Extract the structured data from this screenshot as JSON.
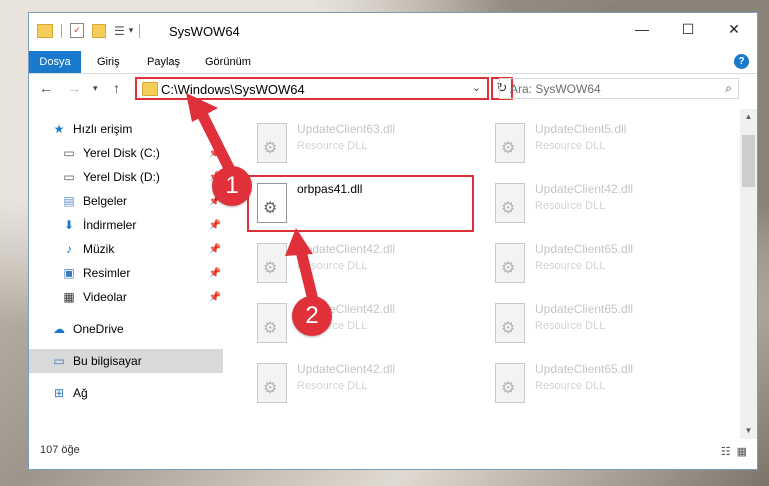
{
  "window": {
    "title": "SysWOW64",
    "controls": {
      "minimize": "—",
      "maximize": "☐",
      "close": "✕"
    }
  },
  "ribbon": {
    "tabs": [
      "Dosya",
      "Giriş",
      "Paylaş",
      "Görünüm"
    ],
    "active_tab": "Dosya",
    "help": "?"
  },
  "address": {
    "path": "C:\\Windows\\SysWOW64",
    "search_placeholder": "Ara: SysWOW64"
  },
  "sidebar": {
    "items": [
      {
        "label": "Hızlı erişim",
        "icon": "star-icon",
        "pinned": false
      },
      {
        "label": "Yerel Disk (C:)",
        "icon": "drive-icon",
        "pinned": true
      },
      {
        "label": "Yerel Disk (D:)",
        "icon": "drive-icon",
        "pinned": true
      },
      {
        "label": "Belgeler",
        "icon": "documents-icon",
        "pinned": true
      },
      {
        "label": "İndirmeler",
        "icon": "download-icon",
        "pinned": true
      },
      {
        "label": "Müzik",
        "icon": "music-icon",
        "pinned": true
      },
      {
        "label": "Resimler",
        "icon": "pictures-icon",
        "pinned": true
      },
      {
        "label": "Videolar",
        "icon": "videos-icon",
        "pinned": true
      },
      {
        "label": "OneDrive",
        "icon": "cloud-icon",
        "pinned": false
      },
      {
        "label": "Bu bilgisayar",
        "icon": "computer-icon",
        "pinned": false,
        "selected": true
      },
      {
        "label": "Ağ",
        "icon": "network-icon",
        "pinned": false
      }
    ]
  },
  "files": [
    {
      "name": "UpdateClient63.dll",
      "type": "Resource DLL"
    },
    {
      "name": "UpdateClient5.dll",
      "type": "Resource DLL"
    },
    {
      "name": "orbpas41.dll",
      "type": "",
      "highlighted": true
    },
    {
      "name": "UpdateClient42.dll",
      "type": "Resource DLL"
    },
    {
      "name": "UpdateClient42.dll",
      "type": "Resource DLL"
    },
    {
      "name": "UpdateClient65.dll",
      "type": "Resource DLL"
    },
    {
      "name": "UpdateClient42.dll",
      "type": "Resource DLL"
    },
    {
      "name": "UpdateClient65.dll",
      "type": "Resource DLL"
    },
    {
      "name": "UpdateClient42.dll",
      "type": "Resource DLL"
    },
    {
      "name": "UpdateClient65.dll",
      "type": "Resource DLL"
    }
  ],
  "status": {
    "count": "107 öğe"
  },
  "annotations": {
    "step1": "1",
    "step2": "2",
    "color": "#e0303a"
  }
}
